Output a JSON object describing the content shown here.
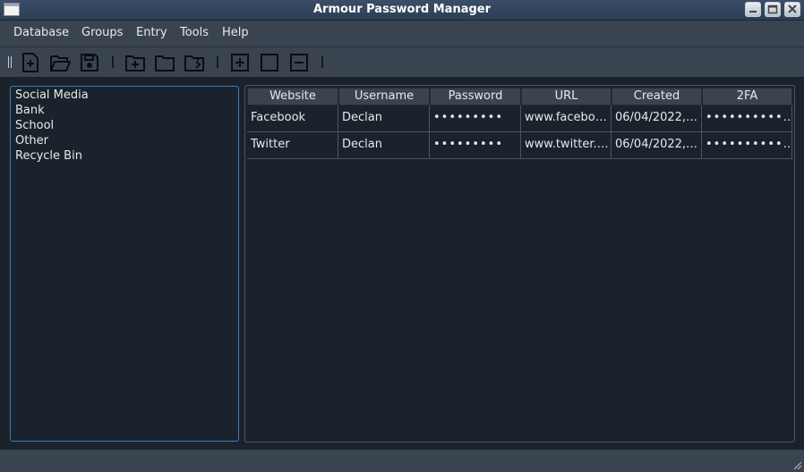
{
  "window": {
    "title": "Armour Password Manager"
  },
  "menu": [
    {
      "label": "Database"
    },
    {
      "label": "Groups"
    },
    {
      "label": "Entry"
    },
    {
      "label": "Tools"
    },
    {
      "label": "Help"
    }
  ],
  "toolbar": {
    "icons": [
      "new-database-icon",
      "open-database-icon",
      "save-database-icon",
      "add-group-icon",
      "folder-icon",
      "edit-group-icon",
      "add-entry-icon",
      "edit-entry-icon",
      "remove-entry-icon"
    ]
  },
  "groups": [
    {
      "label": "Social Media"
    },
    {
      "label": "Bank"
    },
    {
      "label": "School"
    },
    {
      "label": "Other"
    },
    {
      "label": "Recycle Bin"
    }
  ],
  "table": {
    "columns": [
      "Website",
      "Username",
      "Password",
      "URL",
      "Created",
      "2FA"
    ],
    "rows": [
      [
        "Facebook",
        "Declan",
        "•••••••••",
        "www.facebo…",
        "06/04/2022,…",
        "••••••••••…"
      ],
      [
        "Twitter",
        "Declan",
        "•••••••••",
        "www.twitter.…",
        "06/04/2022,…",
        "••••••••••…"
      ]
    ]
  },
  "colors": {
    "accent": "#3a7fc0",
    "background": "#1b222b",
    "chrome": "#3a4451"
  }
}
